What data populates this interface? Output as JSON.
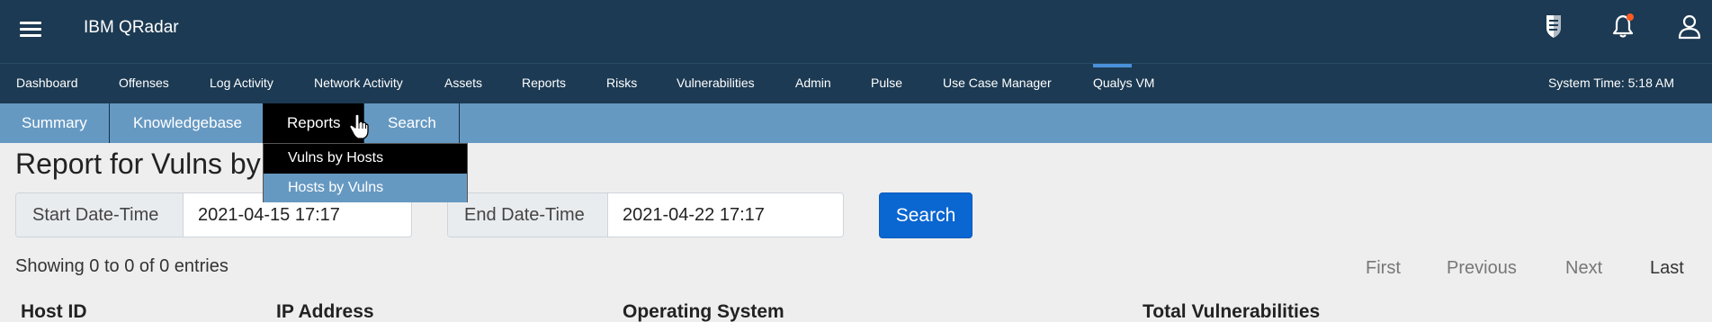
{
  "app": {
    "title": "IBM QRadar"
  },
  "header_icons": [
    "hamburger-icon",
    "shield-icon",
    "bell-icon",
    "user-icon"
  ],
  "main_nav": {
    "items": [
      "Dashboard",
      "Offenses",
      "Log Activity",
      "Network Activity",
      "Assets",
      "Reports",
      "Risks",
      "Vulnerabilities",
      "Admin",
      "Pulse",
      "Use Case Manager",
      "Qualys VM"
    ],
    "active": "Qualys VM",
    "system_time": "System Time: 5:18 AM"
  },
  "sub_nav": {
    "items": [
      "Summary",
      "Knowledgebase",
      "Reports",
      "Search"
    ],
    "active": "Reports"
  },
  "dropdown": {
    "items": [
      "Vulns by Hosts",
      "Hosts by Vulns"
    ],
    "highlighted": "Hosts by Vulns"
  },
  "page": {
    "title": "Report for Vulns by"
  },
  "filters": {
    "start_label": "Start Date-Time",
    "start_value": "2021-04-15 17:17",
    "end_label": "End Date-Time",
    "end_value": "2021-04-22 17:17",
    "search_label": "Search"
  },
  "table": {
    "showing": "Showing 0 to 0 of 0 entries",
    "pagination": [
      "First",
      "Previous",
      "Next",
      "Last"
    ],
    "columns": [
      "Host ID",
      "IP Address",
      "Operating System",
      "Total Vulnerabilities"
    ]
  },
  "colors": {
    "header_bg": "#1c3a53",
    "subnav_bg": "#6699c2",
    "accent": "#4a90d9",
    "button": "#0a66d1",
    "notification_dot": "#ff5a1f"
  }
}
